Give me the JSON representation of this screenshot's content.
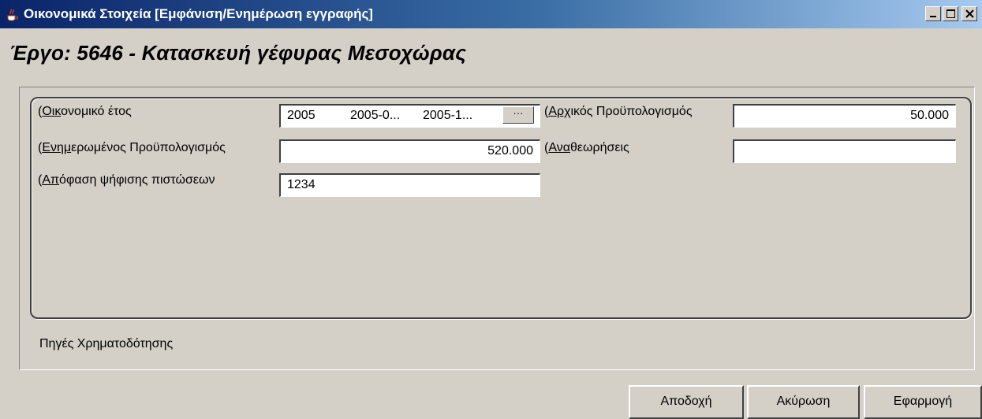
{
  "window": {
    "title": "Οικονομικά Στοιχεία [Εμφάνιση/Ενημέρωση  εγγραφής]",
    "icon": "java-cup-icon"
  },
  "page_title": "Έργο: 5646 - Κατασκευή γέφυρας Μεσοχώρας",
  "form": {
    "fiscal_year": {
      "label_prefix": "Οικ",
      "label_rest": "ονομικό έτος",
      "value_year": "2005",
      "value_start": "2005-0...",
      "value_end": "2005-1...",
      "button_label": "···"
    },
    "updated_budget": {
      "label_prefix": "Ενημ",
      "label_rest": "ερωμένος Προϋπολογισμός",
      "value": "520.000"
    },
    "credit_decision": {
      "label_prefix": "Απ",
      "label_rest": "όφαση ψήφισης πιστώσεων",
      "value": "1234"
    },
    "initial_budget": {
      "label_prefix": "Αρχ",
      "label_rest": "ικός Προϋπολογισμός",
      "value": "50.000"
    },
    "revisions": {
      "label_prefix": "Ανα",
      "label_rest": "θεωρήσεις",
      "value": ""
    }
  },
  "funding_sources_label": "Πηγές Χρηματοδότησης",
  "buttons": {
    "accept": "Αποδοχή",
    "cancel": "Ακύρωση",
    "apply": "Εφαρμογή"
  }
}
